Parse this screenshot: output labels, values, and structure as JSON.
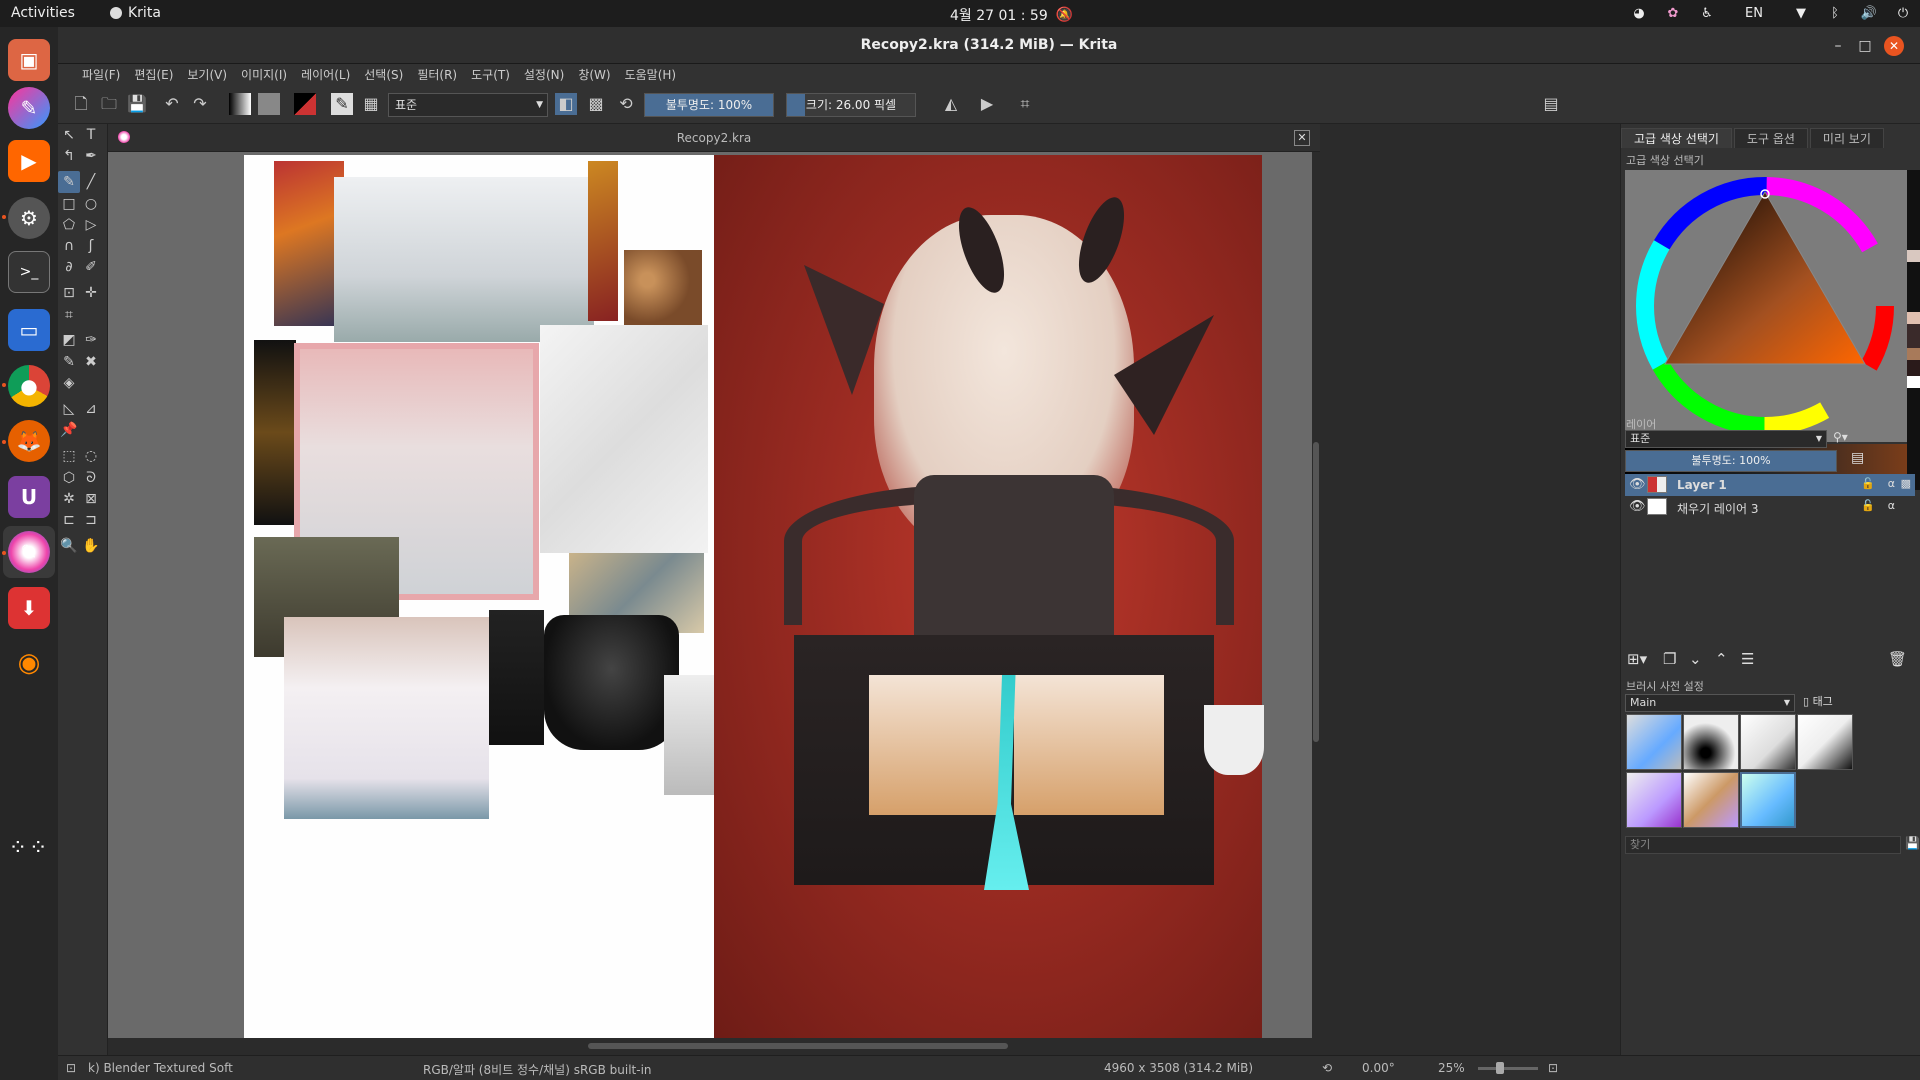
{
  "topbar": {
    "activities": "Activities",
    "app": "Krita",
    "clock": "4월 27  01 : 59",
    "lang": "EN"
  },
  "window": {
    "title": "Recopy2.kra (314.2 MiB)  — Krita"
  },
  "menu": [
    "파일(F)",
    "편집(E)",
    "보기(V)",
    "이미지(I)",
    "레이어(L)",
    "선택(S)",
    "필터(R)",
    "도구(T)",
    "설정(N)",
    "창(W)",
    "도움말(H)"
  ],
  "toolbar": {
    "blend_mode": "표준",
    "opacity_label": "불투명도: 100%",
    "opacity_value": 1.0,
    "size_label": "크기: 26.00 픽셀"
  },
  "canvas": {
    "tab_title": "Recopy2.kra"
  },
  "docker": {
    "tabs": [
      "고급 색상 선택기",
      "도구 옵션",
      "미리 보기"
    ],
    "color_selector_title": "고급 색상 선택기",
    "layers_title": "레이어",
    "layer_blend_mode": "표준",
    "layer_opacity_label": "불투명도: 100%",
    "layers": [
      {
        "name": "Layer 1",
        "selected": true
      },
      {
        "name": "채우기 레이어 3",
        "selected": false
      }
    ],
    "brush_presets_title": "브러시 사전 설정",
    "brush_tag": "Main",
    "brush_tag_button": "태그",
    "search_placeholder": "찾기"
  },
  "status": {
    "brush": "k) Blender Textured Soft",
    "color_space": "RGB/알파 (8비트 정수/채널)  sRGB built-in",
    "dimensions": "4960 x 3508 (314.2 MiB)",
    "rotation": "0.00°",
    "zoom": "25%"
  },
  "colors": {
    "accent": "#e95420",
    "selection": "#4a6d94"
  }
}
